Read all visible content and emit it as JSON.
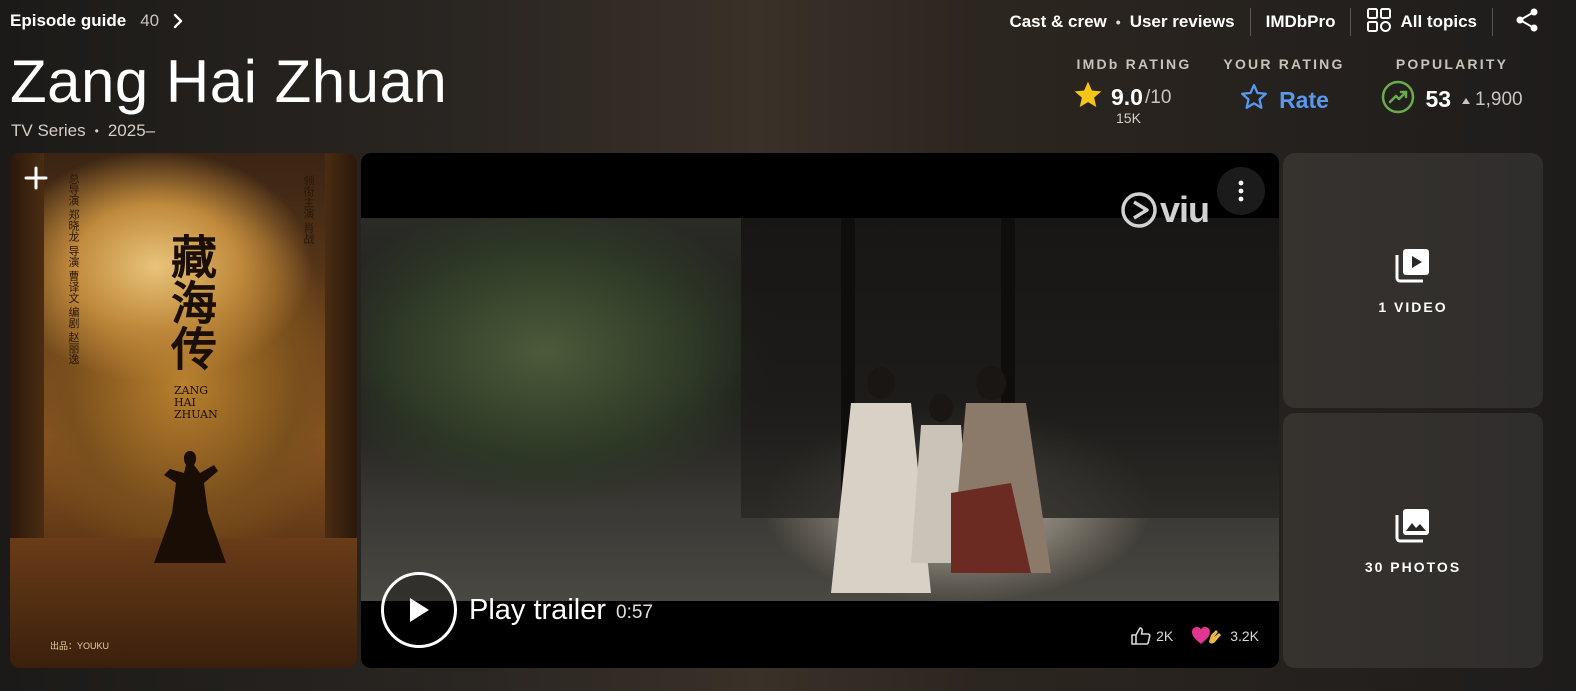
{
  "topbar": {
    "episode_guide_label": "Episode guide",
    "episode_count": "40",
    "links": {
      "cast_crew": "Cast & crew",
      "user_reviews": "User reviews",
      "imdbpro": "IMDbPro",
      "all_topics": "All topics"
    }
  },
  "title": {
    "name": "Zang Hai Zhuan",
    "type": "TV Series",
    "years": "2025–"
  },
  "ratings": {
    "imdb_heading": "IMDb RATING",
    "imdb_value": "9.0",
    "imdb_scale": "/10",
    "imdb_votes": "15K",
    "your_heading": "YOUR RATING",
    "rate_label": "Rate",
    "popularity_heading": "POPULARITY",
    "popularity_rank": "53",
    "popularity_change": "1,900"
  },
  "poster": {
    "title_cjk": "藏海传",
    "title_en_lines": [
      "ZANG",
      "HAI",
      "ZHUAN"
    ],
    "credits_left": "总导演 郑晓龙 导演 曹译文 编剧 赵丽逸",
    "credits_right": "领衔主演 肖战",
    "bottom_strip": "出品：YOUKU"
  },
  "video": {
    "brand": "viu",
    "play_label": "Play trailer",
    "duration": "0:57",
    "likes": "2K",
    "reactions": "3.2K"
  },
  "tiles": {
    "videos_label": "1 VIDEO",
    "photos_label": "30 PHOTOS"
  },
  "colors": {
    "accent_blue": "#5799ef",
    "star_yellow": "#f5c518",
    "trend_green": "#67ad4b"
  }
}
